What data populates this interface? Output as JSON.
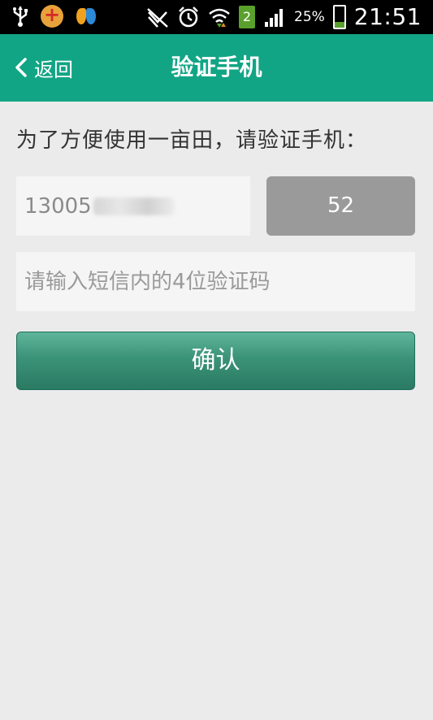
{
  "status_bar": {
    "sim_slot": "2",
    "battery_percent": "25%",
    "battery_level": 0.25,
    "time": "21:51",
    "icons": [
      "usb-icon",
      "shield-app-icon",
      "butterfly-app-icon",
      "signal-muted-icon",
      "alarm-icon",
      "wifi-icon",
      "sim-icon",
      "cell-signal-icon",
      "battery-icon"
    ]
  },
  "header": {
    "back_label": "返回",
    "title": "验证手机",
    "background": "#11a585"
  },
  "form": {
    "prompt": "为了方便使用一亩田，请验证手机：",
    "phone_prefix": "13005",
    "countdown": "52",
    "code_placeholder": "请输入短信内的4位验证码",
    "confirm_label": "确认"
  }
}
